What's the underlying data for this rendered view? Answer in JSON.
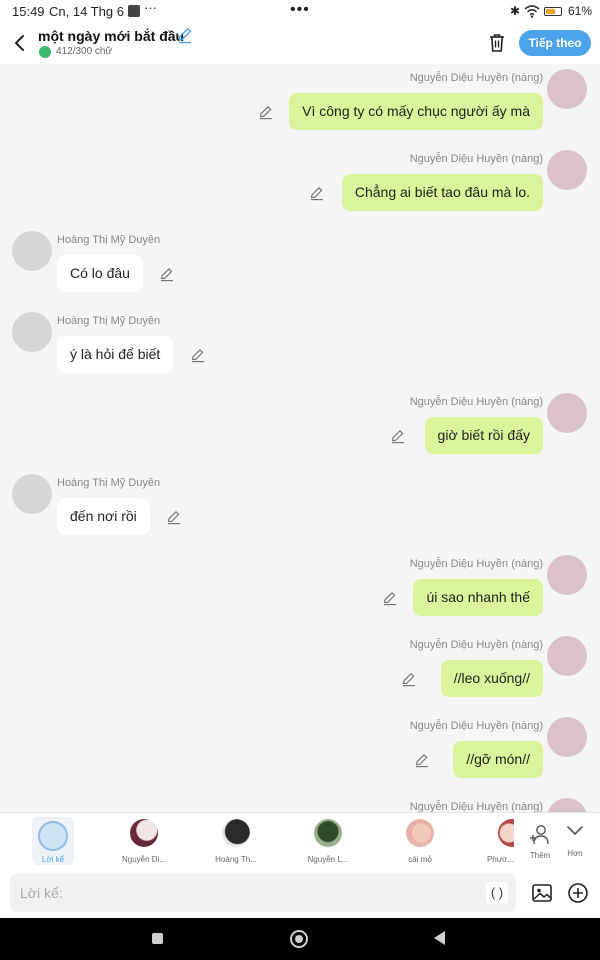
{
  "status_bar": {
    "time": "15:49",
    "date": "Cn, 14 Thg 6",
    "more": "···",
    "center": "•••",
    "battery_percent": "61%",
    "battery_level": 0.61
  },
  "header": {
    "title": "một ngày mới bắt đầu",
    "word_count": "412/300 chữ",
    "next_label": "Tiếp theo"
  },
  "messages": [
    {
      "side": "right",
      "name": "Nguyễn Diệu Huyền (nàng)",
      "text": "Vì công ty có mấy chục người ấy mà"
    },
    {
      "side": "right",
      "name": "Nguyễn Diệu Huyền (nàng)",
      "text": "Chẳng ai biết tao đâu mà lo."
    },
    {
      "side": "left",
      "name": "Hoàng Thị Mỹ Duyên",
      "text": "Có lo đâu"
    },
    {
      "side": "left",
      "name": "Hoàng Thị Mỹ Duyên",
      "text": "ý là hỏi để biết"
    },
    {
      "side": "right",
      "name": "Nguyễn Diệu Huyền (nàng)",
      "text": "giờ biết rồi đấy"
    },
    {
      "side": "left",
      "name": "Hoàng Thị Mỹ Duyên",
      "text": "đến nơi rồi"
    },
    {
      "side": "right",
      "name": "Nguyễn Diệu Huyền (nàng)",
      "text": "úi sao nhanh thế"
    },
    {
      "side": "right",
      "name": "Nguyễn Diệu Huyền (nàng)",
      "text": "//leo xuống//"
    },
    {
      "side": "right",
      "name": "Nguyễn Diệu Huyền (nàng)",
      "text": "//gỡ món//"
    },
    {
      "side": "right",
      "name": "Nguyễn Diệu Huyền (nàng)",
      "text": ""
    }
  ],
  "cast": [
    {
      "name": "Lời kể",
      "selected": true
    },
    {
      "name": "Nguyễn Di..."
    },
    {
      "name": "Hoàng Th..."
    },
    {
      "name": "Nguyễn L..."
    },
    {
      "name": "cái mỏ"
    },
    {
      "name": "Phươ..."
    }
  ],
  "cast_actions": {
    "add_label": "Thêm",
    "more_label": "Hơn"
  },
  "composer": {
    "placeholder": "Lời kể:",
    "paren_label": "( )"
  },
  "colors": {
    "accent": "#4da3ea",
    "bubble_self": "#d9f49a",
    "bubble_other": "#ffffff",
    "background": "#f5f5f5"
  },
  "icons": {
    "back": "chevron-left-icon",
    "title_edit": "pencil-icon",
    "trash": "trash-icon",
    "message_edit": "pencil-icon",
    "image": "image-icon",
    "add": "plus-circle-icon",
    "add_person": "add-person-icon",
    "chevron_down": "chevron-down-icon"
  }
}
